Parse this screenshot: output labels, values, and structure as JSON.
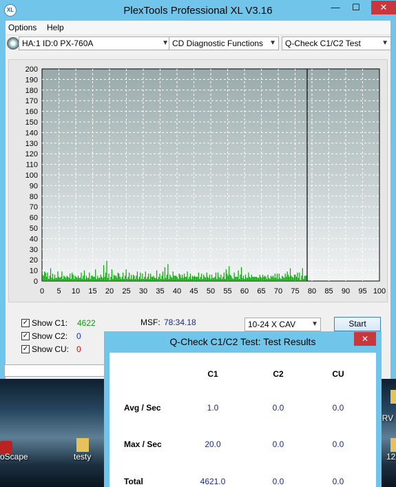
{
  "window": {
    "title": "PlexTools Professional XL V3.16",
    "app_icon_text": "XL",
    "minimize": "—",
    "maximize": "☐",
    "close": "✕"
  },
  "menu": [
    "Options",
    "Help"
  ],
  "toolbar": {
    "drive": "HA:1 ID:0  PX-760A",
    "function": "CD Diagnostic Functions",
    "test": "Q-Check C1/C2 Test"
  },
  "chart_data": {
    "type": "bar",
    "y_ticks": [
      "200",
      "190",
      "180",
      "170",
      "160",
      "150",
      "140",
      "130",
      "120",
      "110",
      "100",
      "90",
      "80",
      "70",
      "60",
      "50",
      "40",
      "30",
      "20",
      "10",
      "0"
    ],
    "x_ticks": [
      "0",
      "5",
      "10",
      "15",
      "20",
      "25",
      "30",
      "35",
      "40",
      "45",
      "50",
      "55",
      "60",
      "65",
      "70",
      "75",
      "80",
      "85",
      "90",
      "95",
      "100"
    ],
    "ylim": [
      0,
      200
    ],
    "xlim": [
      0,
      100
    ],
    "end_marker_x": 78.57,
    "c1_sample_peaks": [
      17,
      8,
      11,
      20,
      6,
      9,
      4,
      7,
      13,
      5,
      9,
      6,
      11,
      4,
      8,
      14,
      5,
      7,
      6,
      10,
      4,
      7,
      12,
      5,
      6,
      9,
      4,
      8,
      5,
      11,
      6,
      4,
      7,
      10,
      5,
      6,
      8,
      4,
      9,
      5,
      7,
      11,
      4,
      6,
      8,
      5,
      10,
      4,
      7,
      6,
      9,
      5,
      12,
      4,
      6,
      8,
      5,
      7,
      10,
      4
    ],
    "colors": {
      "plot_bg_top": "#99aaab",
      "plot_bg_bottom": "#f2f4f4",
      "c1": "#00a800",
      "grid": "#ffffff",
      "marker": "#000000"
    }
  },
  "controls": {
    "show_c1": {
      "label": "Show C1:",
      "value": "4622",
      "checked": "✓",
      "color": "#119911"
    },
    "show_c2": {
      "label": "Show C2:",
      "value": "0",
      "checked": "✓",
      "color": "#1133cc"
    },
    "show_cu": {
      "label": "Show CU:",
      "value": "0",
      "checked": "✓",
      "color": "#cc1111"
    },
    "msf_label": "MSF:",
    "msf_value": "78:34.18",
    "speed": "10-24 X CAV",
    "start": "Start"
  },
  "dialog": {
    "title": "Q-Check C1/C2 Test: Test Results",
    "close": "✕",
    "columns": [
      "C1",
      "C2",
      "CU"
    ],
    "rows": [
      {
        "label": "Avg / Sec",
        "values": [
          "1.0",
          "0.0",
          "0.0"
        ]
      },
      {
        "label": "Max / Sec",
        "values": [
          "20.0",
          "0.0",
          "0.0"
        ]
      },
      {
        "label": "Total",
        "values": [
          "4621.0",
          "0.0",
          "0.0"
        ]
      }
    ]
  },
  "desktop": {
    "icons": [
      {
        "label": "oScape"
      },
      {
        "label": "testy"
      },
      {
        "label": "s DRV"
      },
      {
        "label": "12"
      }
    ]
  }
}
